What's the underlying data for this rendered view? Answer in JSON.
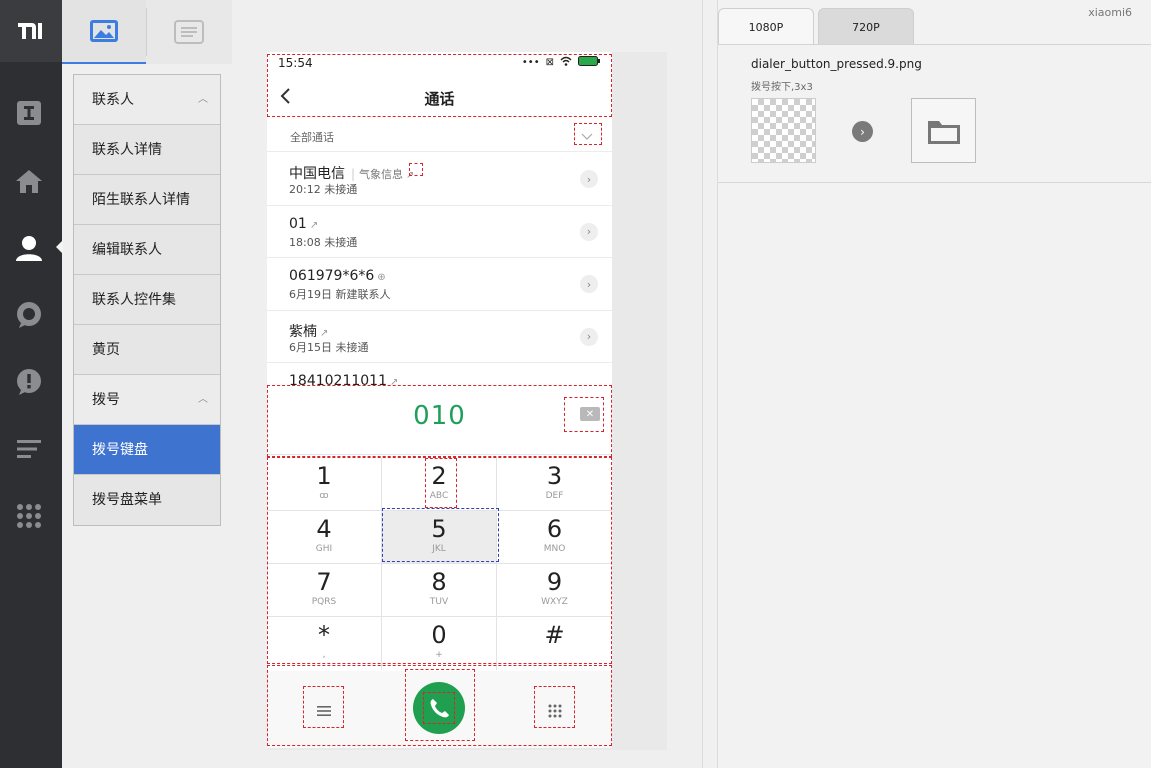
{
  "sidebar": {
    "nav_items": [
      {
        "label": "联系人",
        "type": "group"
      },
      {
        "label": "联系人详情",
        "type": "item"
      },
      {
        "label": "陌生联系人详情",
        "type": "item"
      },
      {
        "label": "编辑联系人",
        "type": "item"
      },
      {
        "label": "联系人控件集",
        "type": "item"
      },
      {
        "label": "黄页",
        "type": "item"
      },
      {
        "label": "拨号",
        "type": "group"
      },
      {
        "label": "拨号键盘",
        "type": "selected"
      },
      {
        "label": "拨号盘菜单",
        "type": "item"
      }
    ]
  },
  "phone": {
    "status_time": "15:54",
    "title": "通话",
    "filter_label": "全部通话",
    "calls": [
      {
        "name": "中国电信",
        "tag": "气象信息",
        "sub": "20:12 未接通"
      },
      {
        "name": "01",
        "tag": "",
        "sub": "18:08 未接通"
      },
      {
        "name": "061979*6*6",
        "tag": "",
        "sub": "6月19日 新建联系人"
      },
      {
        "name": "紫楠",
        "tag": "",
        "sub": "6月15日 未接通"
      },
      {
        "name": "18410211011",
        "tag": "",
        "sub": ""
      }
    ],
    "dialed_number": "010",
    "keys": [
      {
        "num": "1",
        "sub": "ꝏ"
      },
      {
        "num": "2",
        "sub": "ABC"
      },
      {
        "num": "3",
        "sub": "DEF"
      },
      {
        "num": "4",
        "sub": "GHI"
      },
      {
        "num": "5",
        "sub": "JKL"
      },
      {
        "num": "6",
        "sub": "MNO"
      },
      {
        "num": "7",
        "sub": "PQRS"
      },
      {
        "num": "8",
        "sub": "TUV"
      },
      {
        "num": "9",
        "sub": "WXYZ"
      },
      {
        "num": "*",
        "sub": ","
      },
      {
        "num": "0",
        "sub": "+"
      },
      {
        "num": "#",
        "sub": ""
      }
    ]
  },
  "right_panel": {
    "device_label": "xiaomi6",
    "tabs": [
      "1080P",
      "720P"
    ],
    "file_name": "dialer_button_pressed.9.png",
    "file_desc": "拨号按下,3x3"
  },
  "colors": {
    "accent_blue": "#3e73cf",
    "dial_green": "#1f9f4f",
    "guide_red": "#d8242c"
  }
}
